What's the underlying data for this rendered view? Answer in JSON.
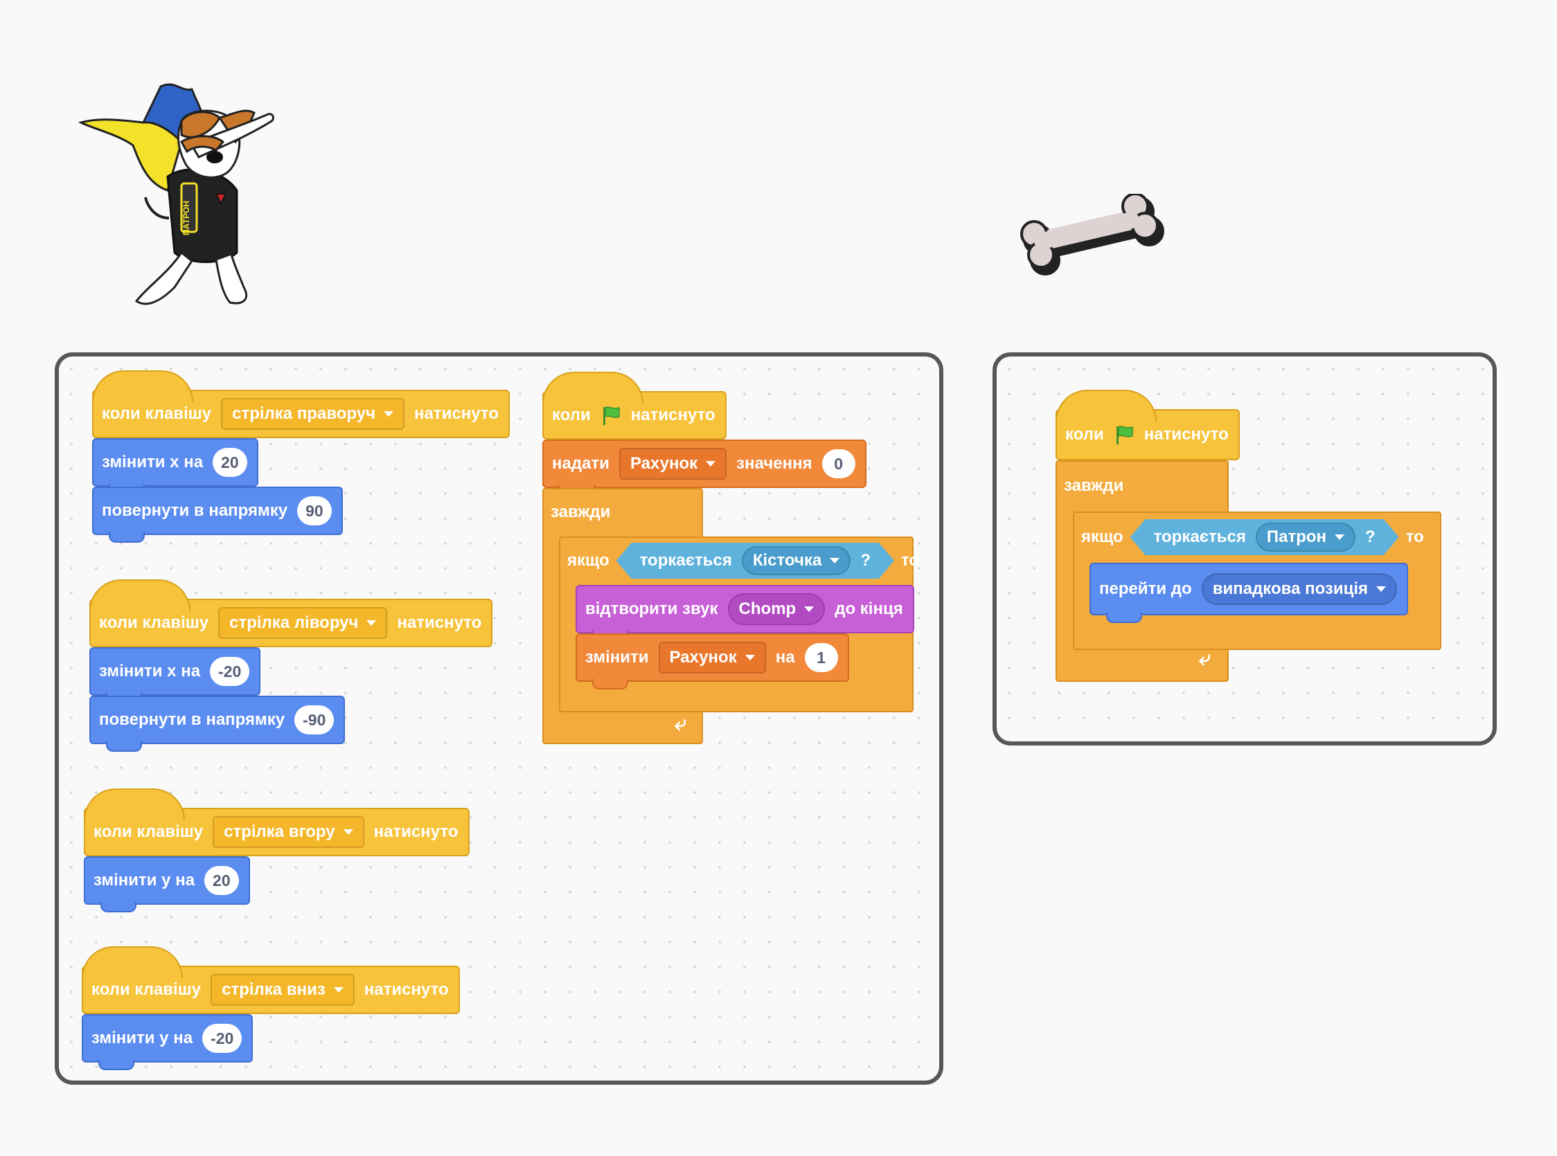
{
  "sprites": {
    "dog": {
      "name": "Патрон",
      "icon": "patron-dog-sprite-icon",
      "badge_text": "ПАТРОН"
    },
    "bone": {
      "name": "Кісточка",
      "icon": "bone-sprite-icon"
    }
  },
  "colors": {
    "events": "#f7c33a",
    "motion": "#5b8cf0",
    "control": "#f4ab3d",
    "variables": "#f1883a",
    "sound": "#c760d6",
    "sensing": "#5fb2dc",
    "panel_border": "#575757"
  },
  "dog_scripts": {
    "right": {
      "prefix": "коли клавішу",
      "key": "стрілка праворуч",
      "suffix": "натиснуто",
      "move_label": "змінити x на",
      "move_value": "20",
      "dir_label": "повернути в напрямку",
      "dir_value": "90"
    },
    "left": {
      "prefix": "коли клавішу",
      "key": "стрілка ліворуч",
      "suffix": "натиснуто",
      "move_label": "змінити x на",
      "move_value": "-20",
      "dir_label": "повернути в напрямку",
      "dir_value": "-90"
    },
    "up": {
      "prefix": "коли клавішу",
      "key": "стрілка вгору",
      "suffix": "натиснуто",
      "move_label": "змінити y на",
      "move_value": "20"
    },
    "down": {
      "prefix": "коли клавішу",
      "key": "стрілка вниз",
      "suffix": "натиснуто",
      "move_label": "змінити y на",
      "move_value": "-20"
    },
    "flag": {
      "when": "коли",
      "clicked": "натиснуто",
      "set_label": "надати",
      "set_var": "Рахунок",
      "set_mid": "значення",
      "set_value": "0",
      "forever": "завжди",
      "if_label": "якщо",
      "touching": "торкається",
      "touch_target": "Кісточка",
      "question": "?",
      "then": "то",
      "play_label": "відтворити звук",
      "sound": "Chomp",
      "play_suffix": "до кінця",
      "change_label": "змінити",
      "change_var": "Рахунок",
      "change_mid": "на",
      "change_value": "1"
    }
  },
  "bone_script": {
    "when": "коли",
    "clicked": "натиснуто",
    "forever": "завжди",
    "if_label": "якщо",
    "touching": "торкається",
    "touch_target": "Патрон",
    "question": "?",
    "then": "то",
    "goto_label": "перейти до",
    "goto_target": "випадкова позиція"
  }
}
